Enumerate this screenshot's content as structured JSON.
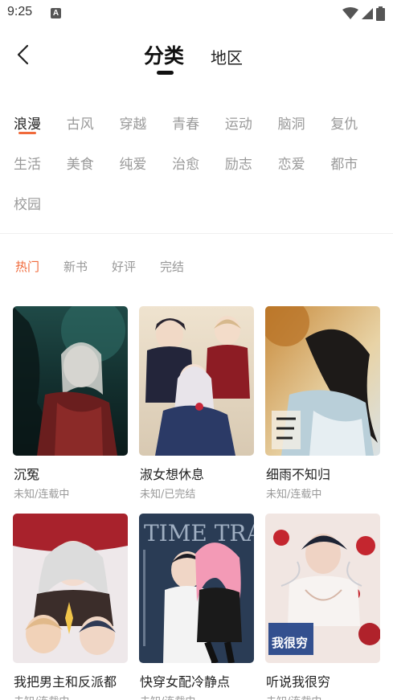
{
  "status_bar": {
    "time": "9:25",
    "badge": "A"
  },
  "header": {
    "tabs": [
      "分类",
      "地区"
    ]
  },
  "categories": {
    "active": "浪漫",
    "rows": [
      [
        "浪漫",
        "古风",
        "穿越",
        "青春",
        "运动",
        "脑洞",
        "复仇"
      ],
      [
        "生活",
        "美食",
        "纯爱",
        "治愈",
        "励志",
        "恋爱",
        "都市"
      ],
      [
        "校园"
      ]
    ]
  },
  "sort": {
    "active": "热门",
    "options": [
      "热门",
      "新书",
      "好评",
      "完结"
    ]
  },
  "books": [
    {
      "title": "沉冤",
      "status": "未知/连载中"
    },
    {
      "title": "淑女想休息",
      "status": "未知/已完结"
    },
    {
      "title": "细雨不知归",
      "status": "未知/连载中"
    },
    {
      "title": "我把男主和反派都",
      "status": "未知/连载中"
    },
    {
      "title": "快穿女配冷静点",
      "status": "未知/连载中"
    },
    {
      "title": "听说我很穷",
      "status": "未知/连载中"
    }
  ],
  "cover_texts": {
    "book6": "我很穷",
    "book5": "TIME TRAVEL"
  },
  "colors": {
    "accent": "#f06a3b",
    "inactive": "#999999",
    "text": "#222222"
  }
}
